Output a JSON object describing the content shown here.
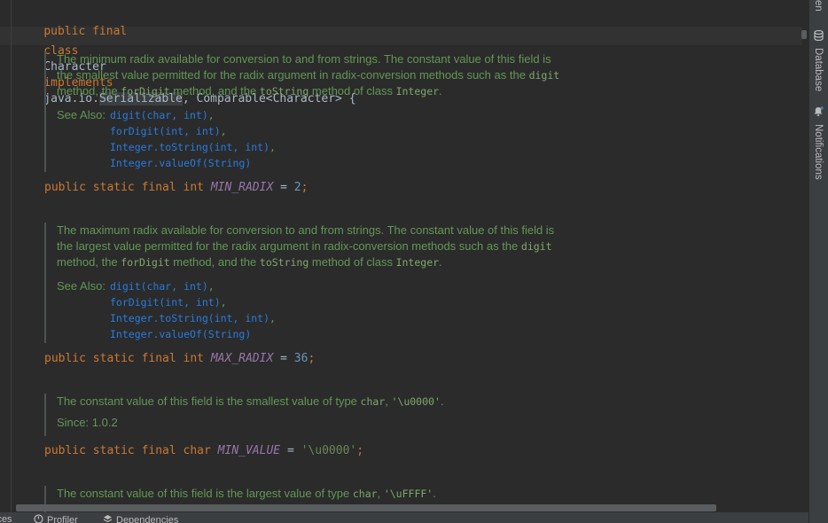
{
  "class_header": {
    "line1": "public final",
    "line2_class_kw": "class",
    "line2_name": "Character",
    "line2_implements": "implements",
    "line2_pkg": "java.io.",
    "line2_serializable": "Serializable",
    "line2_rest": ", Comparable<Character> {"
  },
  "fields": [
    {
      "doc_text_1": "The minimum radix available for conversion to and from strings. The constant value of this field is",
      "doc_text_2": "the smallest value permitted for the radix argument in radix-conversion methods such as the",
      "doc_code_digit": "digit",
      "doc_text_3a": "method, the",
      "doc_code_fordigit": "forDigit",
      "doc_text_3b": "method, and the",
      "doc_code_tostring": "toString",
      "doc_text_3c": "method of class",
      "doc_code_integer": "Integer",
      "doc_text_3d": ".",
      "see_also_label": "See Also:",
      "see_also": [
        "digit(char, int)",
        "forDigit(int, int)",
        "Integer.toString(int, int)",
        "Integer.valueOf(String)"
      ],
      "decl_modifiers": "public static final int",
      "decl_name": "MIN_RADIX",
      "decl_eq": " = ",
      "decl_value": "2",
      "decl_end": ";"
    },
    {
      "doc_text_1": "The maximum radix available for conversion to and from strings. The constant value of this field is",
      "doc_text_2": "the largest value permitted for the radix argument in radix-conversion methods such as the",
      "doc_code_digit": "digit",
      "doc_text_3a": "method, the",
      "doc_code_fordigit": "forDigit",
      "doc_text_3b": "method, and the",
      "doc_code_tostring": "toString",
      "doc_text_3c": "method of class",
      "doc_code_integer": "Integer",
      "doc_text_3d": ".",
      "see_also_label": "See Also:",
      "see_also": [
        "digit(char, int)",
        "forDigit(int, int)",
        "Integer.toString(int, int)",
        "Integer.valueOf(String)"
      ],
      "decl_modifiers": "public static final int",
      "decl_name": "MAX_RADIX",
      "decl_eq": " = ",
      "decl_value": "36",
      "decl_end": ";"
    },
    {
      "doc_text_a": "The constant value of this field is the smallest value of type",
      "doc_code_char": "char",
      "doc_sep": ",",
      "doc_code_val": "'\\u0000'",
      "doc_end": ".",
      "since_label": "Since:",
      "since_value": "1.0.2",
      "decl_modifiers": "public static final char",
      "decl_name": "MIN_VALUE",
      "decl_eq": " = ",
      "decl_value": "'\\u0000'",
      "decl_end": ";"
    },
    {
      "doc_text_a": "The constant value of this field is the largest value of type",
      "doc_code_char": "char",
      "doc_sep": ",",
      "doc_code_val": "'\\uFFFF'",
      "doc_end": "."
    }
  ],
  "right_panel": {
    "top_fragment": "en",
    "database_label": "Database",
    "database_icon": "database-icon",
    "notifications_label": "Notifications",
    "notifications_icon": "bell-icon"
  },
  "bottom_bar": {
    "left_fragment": "ices",
    "profiler_label": "Profiler",
    "profiler_icon": "profiler-icon",
    "dependencies_label": "Dependencies",
    "dependencies_icon": "dependencies-icon"
  },
  "colors": {
    "background": "#2b2b2b",
    "keyword": "#cc7832",
    "field": "#9876aa",
    "number": "#6897bb",
    "string": "#6a8759",
    "doc": "#629755",
    "link": "#287bde"
  }
}
